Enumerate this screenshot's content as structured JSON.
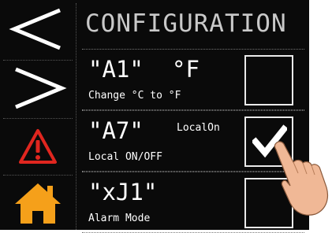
{
  "screen_title": "CONFIGURATION",
  "sidebar": {
    "items": [
      {
        "icon": "chevron-left-icon"
      },
      {
        "icon": "chevron-right-icon"
      },
      {
        "icon": "alarm-warning-icon",
        "color": "#e0261f"
      },
      {
        "icon": "home-icon",
        "color": "#f5a01a"
      }
    ]
  },
  "params": [
    {
      "code": "\"A1\"",
      "unit": "°F",
      "description": "Change °C to °F",
      "checked": false
    },
    {
      "code": "\"A7\"",
      "status": "LocalOn",
      "description": "Local ON/OFF",
      "checked": true
    },
    {
      "code": "\"xJ1\"",
      "description": "Alarm Mode",
      "checked": false
    }
  ],
  "colors": {
    "background": "#0a0a0a",
    "text": "#ffffff",
    "title": "#c9c9c9",
    "alarm": "#e0261f",
    "home": "#f5a01a"
  }
}
